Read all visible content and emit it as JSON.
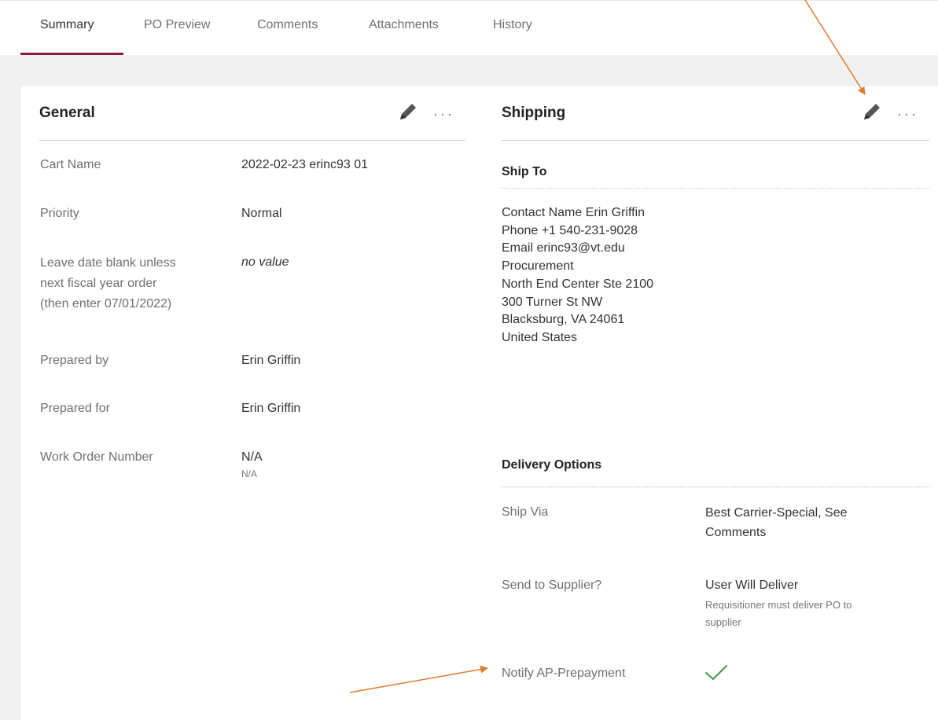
{
  "tabs": [
    {
      "label": "Summary",
      "active": true
    },
    {
      "label": "PO Preview",
      "active": false
    },
    {
      "label": "Comments",
      "active": false
    },
    {
      "label": "Attachments",
      "active": false
    },
    {
      "label": "History",
      "active": false
    }
  ],
  "colors": {
    "accent": "#8b1a3c",
    "annotation_arrow": "#e07a2f",
    "check": "#3c9a3c"
  },
  "general": {
    "title": "General",
    "fields": [
      {
        "label": "Cart Name",
        "value": "2022-02-23 erinc93 01"
      },
      {
        "label": "Priority",
        "value": "Normal"
      },
      {
        "label": "Leave date blank unless next fiscal year order (then enter 07/01/2022)",
        "label_lines": [
          "Leave date blank unless",
          "next fiscal year order",
          "(then enter 07/01/2022)"
        ],
        "value": "no value"
      },
      {
        "label": "Prepared by",
        "value": "Erin Griffin"
      },
      {
        "label": "Prepared for",
        "value": "Erin Griffin"
      },
      {
        "label": "Work Order Number",
        "value": "N/A",
        "subvalue": "N/A"
      }
    ]
  },
  "shipping": {
    "title": "Shipping",
    "ship_to": {
      "heading": "Ship To",
      "lines": [
        "Contact Name Erin Griffin",
        "Phone +1 540-231-9028",
        "Email erinc93@vt.edu",
        "Procurement",
        "North End Center Ste 2100",
        "300 Turner St NW",
        "Blacksburg, VA 24061",
        "United States"
      ]
    },
    "delivery": {
      "heading": "Delivery Options",
      "ship_via_label": "Ship Via",
      "ship_via_value_lines": [
        "Best Carrier-Special, See",
        "Comments"
      ],
      "send_label": "Send to Supplier?",
      "send_value": "User Will Deliver",
      "send_sub_lines": [
        "Requisitioner must deliver PO to",
        "supplier"
      ],
      "notify_label": "Notify AP-Prepayment",
      "notify_icon": "checkmark-icon"
    }
  },
  "icons": {
    "edit": "pencil-icon",
    "more": "more-options-icon"
  }
}
